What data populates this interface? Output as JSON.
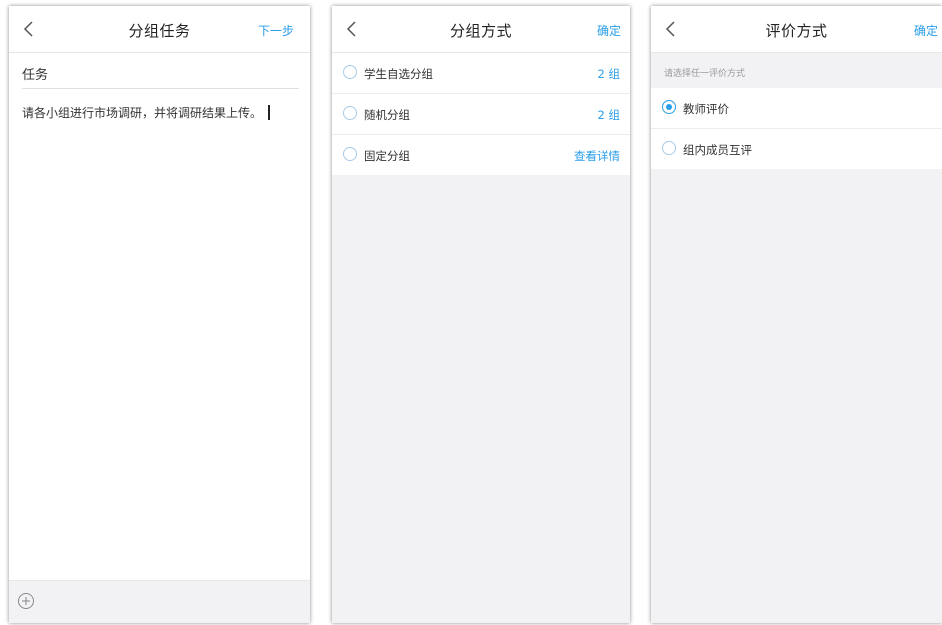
{
  "screen1": {
    "title": "分组任务",
    "next_label": "下一步",
    "field_label": "任务",
    "task_text": "请各小组进行市场调研，并将调研结果上传。"
  },
  "screen2": {
    "title": "分组方式",
    "confirm_label": "确定",
    "options": [
      {
        "label": "学生自选分组",
        "right": "2 组",
        "selected": false
      },
      {
        "label": "随机分组",
        "right": "2 组",
        "selected": false
      },
      {
        "label": "固定分组",
        "right": "查看详情",
        "selected": false
      }
    ]
  },
  "screen3": {
    "title": "评价方式",
    "confirm_label": "确定",
    "hint": "请选择任一评价方式",
    "options": [
      {
        "label": "教师评价",
        "selected": true
      },
      {
        "label": "组内成员互评",
        "selected": false
      }
    ]
  },
  "colors": {
    "accent": "#2a9ee8",
    "background": "#f2f2f4"
  },
  "icons": {
    "back": "chevron-left-icon",
    "add": "plus-circle-icon"
  }
}
